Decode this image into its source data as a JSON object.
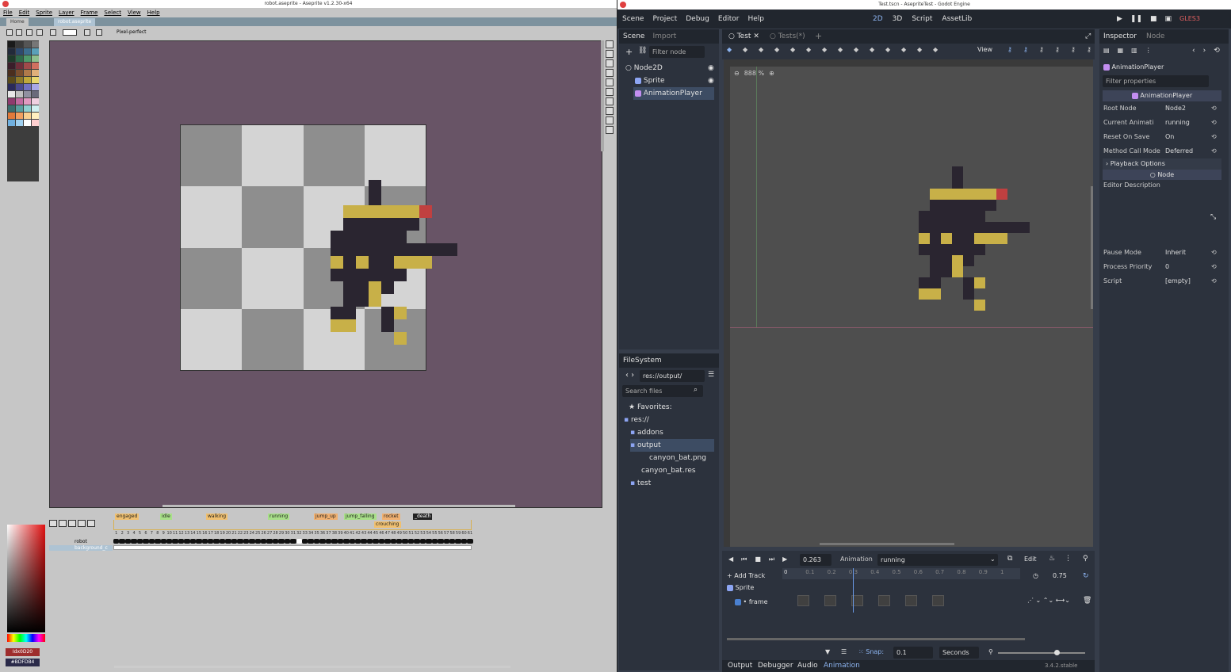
{
  "aseprite": {
    "window_title": "robot.aseprite - Aseprite v1.2.30-x64",
    "menu": [
      "File",
      "Edit",
      "Sprite",
      "Layer",
      "Frame",
      "Select",
      "View",
      "Help"
    ],
    "tabs": [
      "Home",
      "robot.aseprite"
    ],
    "context_option": "Pixel-perfect",
    "timeline": {
      "tags": [
        "engaged",
        "idle",
        "walking",
        "running",
        "jump_up",
        "jump_falling",
        "rocket",
        "crouching",
        "_death"
      ],
      "layers": [
        "robot",
        "background_c"
      ],
      "frame_numbers": [
        "1",
        "2",
        "3",
        "4",
        "5",
        "6",
        "7",
        "8",
        "9",
        "10",
        "11",
        "12",
        "13",
        "14",
        "15",
        "16",
        "17",
        "18",
        "19",
        "20",
        "21",
        "22",
        "23",
        "24",
        "25",
        "26",
        "27",
        "28",
        "29",
        "30",
        "31",
        "32",
        "33",
        "34",
        "35",
        "36",
        "37",
        "38",
        "39",
        "40",
        "41",
        "42",
        "43",
        "44",
        "45",
        "46",
        "47",
        "48",
        "49",
        "50",
        "51",
        "52",
        "53",
        "54",
        "55",
        "56",
        "57",
        "58",
        "59",
        "60",
        "61"
      ]
    },
    "fg_color_label": "Idx0D20",
    "bg_color_label": "#BDFDB4"
  },
  "godot": {
    "window_title": "Test.tscn - AsepriteTest - Godot Engine",
    "menu": [
      "Scene",
      "Project",
      "Debug",
      "Editor",
      "Help"
    ],
    "workspaces": [
      "2D",
      "3D",
      "Script",
      "AssetLib"
    ],
    "renderer": "GLES3",
    "scene_dock": {
      "tabs": [
        "Scene",
        "Import"
      ],
      "filter_placeholder": "Filter node",
      "tree": [
        "Node2D",
        "Sprite",
        "AnimationPlayer"
      ]
    },
    "scene_tabs": [
      "Test",
      "Tests(*)"
    ],
    "viewport_toolbar": {
      "view_label": "View",
      "zoom": "888 %"
    },
    "filesystem": {
      "title": "FileSystem",
      "path": "res://output/",
      "search_placeholder": "Search files",
      "favorites": "Favorites:",
      "items": [
        "res://",
        "addons",
        "output",
        "canyon_bat.png",
        "canyon_bat.res",
        "test"
      ]
    },
    "animation": {
      "time": "0.263",
      "label": "Animation",
      "current": "running",
      "edit_label": "Edit",
      "add_track": "Add Track",
      "ruler": [
        "0",
        "0.1",
        "0.2",
        "0.3",
        "0.4",
        "0.5",
        "0.6",
        "0.7",
        "0.8",
        "0.9",
        "1"
      ],
      "length": "0.75",
      "track_group": "Sprite",
      "track": "frame",
      "snap_label": "Snap:",
      "snap_value": "0.1",
      "snap_unit": "Seconds"
    },
    "bottom_tabs": [
      "Output",
      "Debugger",
      "Audio",
      "Animation"
    ],
    "version": "3.4.2.stable",
    "inspector": {
      "tabs": [
        "Inspector",
        "Node"
      ],
      "object": "AnimationPlayer",
      "filter_placeholder": "Filter properties",
      "class_header": "AnimationPlayer",
      "props": [
        {
          "name": "Root Node",
          "value": "Node2"
        },
        {
          "name": "Current Animati",
          "value": "running"
        },
        {
          "name": "Reset On Save",
          "value": "On"
        },
        {
          "name": "Method Call Mode",
          "value": "Deferred"
        }
      ],
      "playback_options": "Playback Options",
      "node_header": "Node",
      "editor_description": "Editor Description",
      "props2": [
        {
          "name": "Pause Mode",
          "value": "Inherit"
        },
        {
          "name": "Process Priority",
          "value": "0"
        },
        {
          "name": "Script",
          "value": "[empty]"
        }
      ]
    }
  }
}
